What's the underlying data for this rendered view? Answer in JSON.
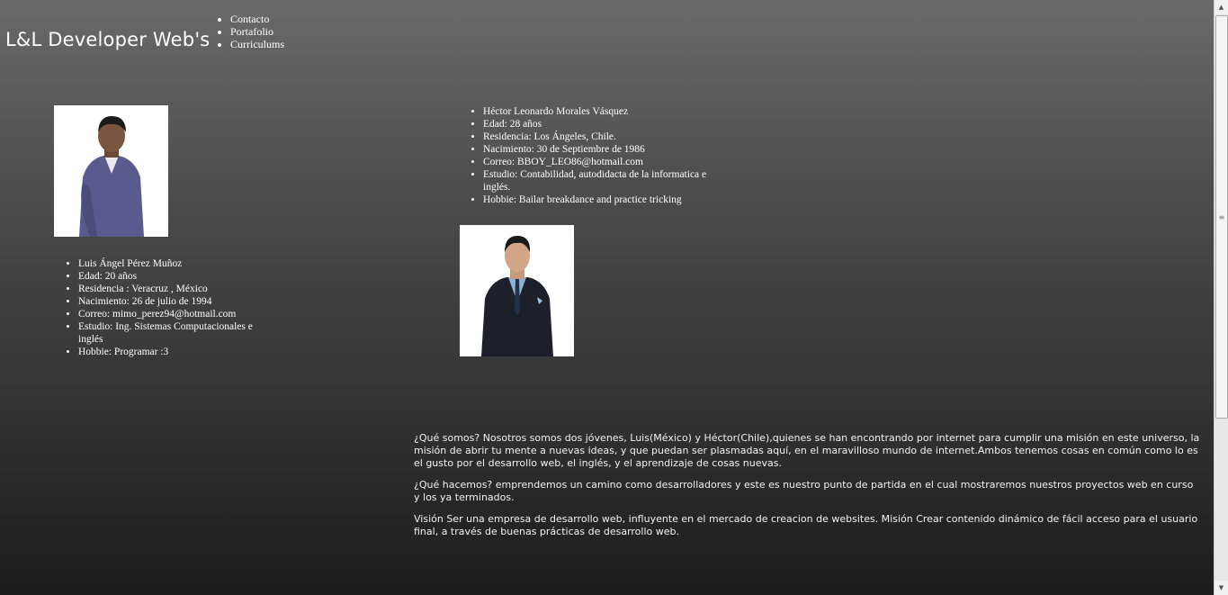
{
  "brand": {
    "title": "L&L Developer Web's"
  },
  "nav": {
    "items": [
      "Contacto",
      "Portafolio",
      "Curriculums"
    ]
  },
  "person1": {
    "photo_icon": "person-portrait-icon",
    "details": [
      "Luis Ángel Pérez Muñoz",
      "Edad: 20 años",
      "Residencia : Veracruz , México",
      "Nacimiento: 26 de julio de 1994",
      "Correo: mimo_perez94@hotmail.com",
      "Estudio: Ing. Sistemas Computacionales e inglés",
      "Hobbie: Programar :3"
    ]
  },
  "person2": {
    "photo_icon": "person-portrait-icon",
    "details": [
      "Héctor Leonardo Morales Vásquez",
      "Edad: 28 años",
      "Residencia: Los Ángeles, Chile.",
      "Nacimiento: 30 de Septiembre de 1986",
      "Correo: BBOY_LEO86@hotmail.com",
      "Estudio: Contabilidad, autodidacta de la informatica e inglés.",
      "Hobbie: Bailar breakdance and practice tricking"
    ]
  },
  "about": {
    "que_somos": "¿Qué somos? Nosotros somos dos jóvenes, Luis(México) y Héctor(Chile),quienes se han encontrando por internet para cumplir una misión en este universo, la misión de abrir tu mente a nuevas ideas, y que puedan ser plasmadas aquí, en el maravilloso mundo de internet.Ambos tenemos cosas en común como lo es el gusto por el desarrollo web, el inglés, y el aprendizaje de cosas nuevas.",
    "que_hacemos": "¿Qué hacemos? emprendemos un camino como desarrolladores y este es nuestro punto de partida en el cual mostraremos nuestros proyectos web en curso y los ya terminados.",
    "vision_mision": "Visión Ser una empresa de desarrollo web, influyente en el mercado de creacion de websites. Misión Crear contenido dinámico de fácil acceso para el usuario final, a través de buenas prácticas de desarrollo web."
  },
  "scrollbar": {
    "up_icon": "arrow-up-icon",
    "down_icon": "arrow-down-icon",
    "grip_icon": "grip-icon"
  }
}
